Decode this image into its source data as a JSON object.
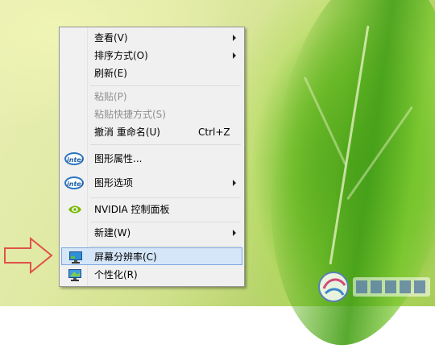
{
  "menu": {
    "items": [
      {
        "label": "查看(V)",
        "submenu": true,
        "disabled": false
      },
      {
        "label": "排序方式(O)",
        "submenu": true,
        "disabled": false
      },
      {
        "label": "刷新(E)",
        "submenu": false,
        "disabled": false
      },
      {
        "label": "粘贴(P)",
        "submenu": false,
        "disabled": true
      },
      {
        "label": "粘贴快捷方式(S)",
        "submenu": false,
        "disabled": true
      },
      {
        "label": "撤消 重命名(U)",
        "shortcut": "Ctrl+Z",
        "submenu": false,
        "disabled": false
      },
      {
        "label": "图形属性...",
        "icon": "intel-icon",
        "submenu": false,
        "disabled": false
      },
      {
        "label": "图形选项",
        "icon": "intel-icon",
        "submenu": true,
        "disabled": false
      },
      {
        "label": "NVIDIA 控制面板",
        "icon": "nvidia-icon",
        "submenu": false,
        "disabled": false
      },
      {
        "label": "新建(W)",
        "submenu": true,
        "disabled": false
      },
      {
        "label": "屏幕分辨率(C)",
        "icon": "display-icon",
        "submenu": false,
        "disabled": false,
        "highlighted": true
      },
      {
        "label": "个性化(R)",
        "icon": "personalize-icon",
        "submenu": false,
        "disabled": false
      }
    ]
  },
  "icons": {
    "intel_text": "intel"
  },
  "colors": {
    "highlight_bg": "#d5e6f8",
    "highlight_border": "#7aa7dd",
    "pointer_arrow": "#e0524a"
  }
}
